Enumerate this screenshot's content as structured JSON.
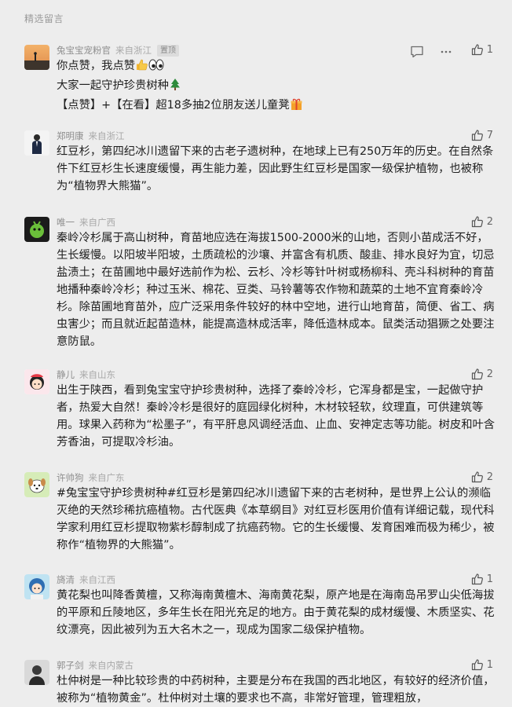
{
  "header": {
    "title": "精选留言"
  },
  "comments": [
    {
      "name": "兔宝宝宠粉官",
      "location": "来自浙江",
      "badge": "置顶",
      "likes": "1",
      "lines": [
        "你点赞，我点赞",
        "大家一起守护珍贵树种",
        "【点赞】+【在看】超18多抽2位朋友送儿童凳"
      ],
      "avatar_icon": "sunset-landscape-avatar",
      "actions": [
        "comment-icon",
        "more-icon"
      ]
    },
    {
      "name": "郑明康",
      "location": "来自浙江",
      "likes": "7",
      "text": "红豆杉，第四纪冰川遗留下来的古老子遗树种，在地球上已有250万年的历史。在自然条件下红豆杉生长速度缓慢，再生能力差，因此野生红豆杉是国家一级保护植物，也被称为“植物界大熊猫”。",
      "avatar_icon": "person-in-suit-avatar"
    },
    {
      "name": "唯一",
      "location": "来自广西",
      "likes": "2",
      "text": "秦岭冷杉属于高山树种，育苗地应选在海拔1500-2000米的山地，否则小苗成活不好，生长缓慢。以阳坡半阳坡，土质疏松的沙壤、并富含有机质、酸韭、排水良好为宜，切忌盐渍土；在苗圃地中最好选前作为松、云杉、冷杉等针叶树或杨柳科、壳斗科树种的育苗地播种秦岭冷杉；种过玉米、棉花、豆类、马铃薯等农作物和蔬菜的土地不宜育秦岭冷杉。除苗圃地育苗外，应广泛采用条件较好的林中空地，进行山地育苗，简便、省工、病虫害少；而且就近起苗造林，能提高造林成活率，降低造林成本。鼠类活动猖獗之处要注意防鼠。",
      "avatar_icon": "green-creature-avatar"
    },
    {
      "name": "静儿",
      "location": "来自山东",
      "likes": "2",
      "text": "出生于陕西，看到兔宝宝守护珍贵树种，选择了秦岭冷杉，它浑身都是宝，一起做守护者，热爱大自然！秦岭冷杉是很好的庭园绿化树种，木材较轻软，纹理直，可供建筑等用。球果入药称为“松墨子”，有平肝息风调经活血、止血、安神定志等功能。树皮和叶含芳香油，可提取冷杉油。",
      "avatar_icon": "cartoon-girl-avatar"
    },
    {
      "name": "许帅狗",
      "location": "来自广东",
      "likes": "2",
      "text": "#兔宝宝守护珍贵树种#红豆杉是第四纪冰川遗留下来的古老树种，是世界上公认的濒临灭绝的天然珍稀抗癌植物。古代医典《本草纲目》对红豆杉医用价值有详细记载，现代科学家利用红豆杉提取物紫杉醇制成了抗癌药物。它的生长缓慢、发育困难而极为稀少，被称作“植物界的大熊猫”。",
      "avatar_icon": "cartoon-dog-avatar"
    },
    {
      "name": "旖清",
      "location": "来自江西",
      "likes": "1",
      "text": "黄花梨也叫降香黄檀，又称海南黄檀木、海南黄花梨，原产地是在海南岛吊罗山尖低海拔的平原和丘陵地区，多年生长在阳光充足的地方。由于黄花梨的成材缓慢、木质坚实、花纹漂亮，因此被列为五大名木之一，现成为国家二级保护植物。",
      "avatar_icon": "blue-hair-girl-avatar"
    },
    {
      "name": "郭子剑",
      "location": "来自内蒙古",
      "likes": "1",
      "text": "杜仲树是一种比较珍贵的中药树种，主要是分布在我国的西北地区，有较好的经济价值，被称为“植物黄金”。杜仲树对土壤的要求也不高，非常好管理，管理粗放，",
      "avatar_icon": "dark-portrait-avatar"
    }
  ],
  "colors": {
    "background": "#ededed",
    "meta_text": "#8e8e8e",
    "body_text": "#1f1f1f",
    "like_icon": "#555555"
  }
}
